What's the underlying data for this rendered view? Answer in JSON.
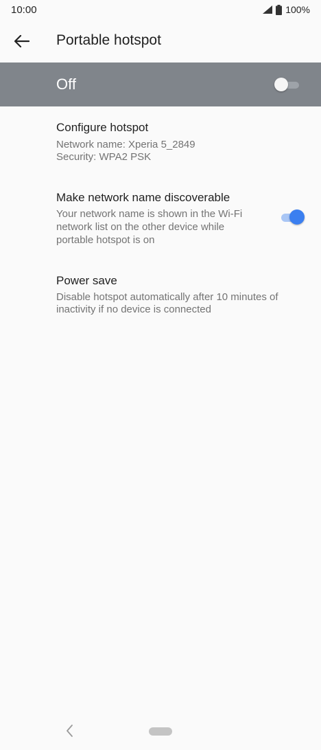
{
  "status_bar": {
    "time": "10:00",
    "battery": "100%",
    "icons": [
      "signal-icon",
      "battery-icon"
    ]
  },
  "app_bar": {
    "back_icon": "arrow-back-icon",
    "title": "Portable hotspot"
  },
  "master_switch": {
    "label": "Off",
    "checked": false
  },
  "settings": [
    {
      "title": "Configure hotspot",
      "summary_lines": [
        "Network name: Xperia 5_2849",
        "Security: WPA2 PSK"
      ]
    },
    {
      "title": "Make network name discoverable",
      "summary_lines": [
        "Your network name is shown in the Wi-Fi",
        "network list on the other device while",
        "portable hotspot is on"
      ],
      "checked": true
    },
    {
      "title": "Power save",
      "summary_lines": [
        "Disable hotspot automatically after 10 minutes of",
        "inactivity if no device is connected"
      ]
    }
  ],
  "nav_bar": {
    "back_icon": "nav-back-icon",
    "home_icon": "nav-home-pill"
  },
  "colors": {
    "background": "#fafafa",
    "master_bar": "#80858b",
    "accent": "#3b7ff0",
    "accent_track": "#a9c6f5",
    "primary_text": "#212121",
    "secondary_text": "#737373"
  }
}
